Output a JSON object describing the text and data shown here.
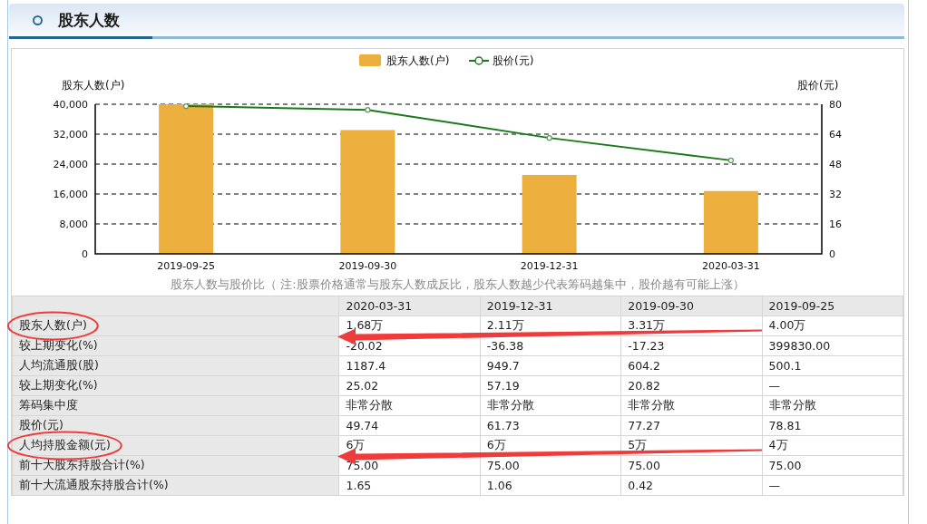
{
  "section": {
    "title": "股东人数"
  },
  "chart": {
    "chart_data": {
      "type": "bar",
      "legend": "top",
      "grid": true,
      "ylabel": "股东人数(户)",
      "y2label": "股价(元)",
      "categories": [
        "2019-09-25",
        "2019-09-30",
        "2019-12-31",
        "2020-03-31"
      ],
      "series": [
        {
          "name": "股东人数(户)",
          "color": "#ecae3c",
          "values": [
            40000,
            33100,
            21100,
            16800
          ]
        },
        {
          "name": "股价(元)",
          "type": "line",
          "axis": "y2",
          "marker": "circle",
          "color": "#1a7a1a",
          "values": [
            79,
            77,
            62,
            50
          ]
        }
      ],
      "ylim": [
        0,
        40000
      ],
      "yticks": [
        {
          "value": 0,
          "label": "0"
        },
        {
          "value": 8000,
          "label": "8,000"
        },
        {
          "value": 16000,
          "label": "16,000"
        },
        {
          "value": 24000,
          "label": "24,000"
        },
        {
          "value": 32000,
          "label": "32,000"
        },
        {
          "value": 40000,
          "label": "40,000"
        }
      ],
      "y2lim": [
        0,
        80
      ],
      "y2ticks": [
        0,
        16,
        32,
        48,
        64,
        80
      ]
    },
    "caption": "股东人数与股价比（ 注:股票价格通常与股东人数成反比，股东人数越少代表筹码越集中，股价越有可能上涨）"
  },
  "table": {
    "columns": [
      "2020-03-31",
      "2019-12-31",
      "2019-09-30",
      "2019-09-25"
    ],
    "rows": [
      {
        "label": "股东人数(户)",
        "circled": true,
        "cells": [
          "1.68万",
          "2.11万",
          "3.31万",
          "4.00万"
        ]
      },
      {
        "label": "较上期变化(%)",
        "circled": false,
        "cells": [
          "-20.02",
          "-36.38",
          "-17.23",
          "399830.00"
        ]
      },
      {
        "label": "人均流通股(股)",
        "circled": false,
        "cells": [
          "1187.4",
          "949.7",
          "604.2",
          "500.1"
        ]
      },
      {
        "label": "较上期变化(%)",
        "circled": false,
        "cells": [
          "25.02",
          "57.19",
          "20.82",
          "—"
        ]
      },
      {
        "label": "筹码集中度",
        "circled": false,
        "cells": [
          "非常分散",
          "非常分散",
          "非常分散",
          "非常分散"
        ]
      },
      {
        "label": "股价(元)",
        "circled": false,
        "cells": [
          "49.74",
          "61.73",
          "77.27",
          "78.81"
        ]
      },
      {
        "label": "人均持股金额(元)",
        "circled": true,
        "cells": [
          "6万",
          "6万",
          "5万",
          "4万"
        ]
      },
      {
        "label": "前十大股东持股合计(%)",
        "circled": false,
        "cells": [
          "75.00",
          "75.00",
          "75.00",
          "75.00"
        ]
      },
      {
        "label": "前十大流通股东持股合计(%)",
        "circled": false,
        "cells": [
          "1.65",
          "1.06",
          "0.42",
          "—"
        ]
      }
    ]
  }
}
